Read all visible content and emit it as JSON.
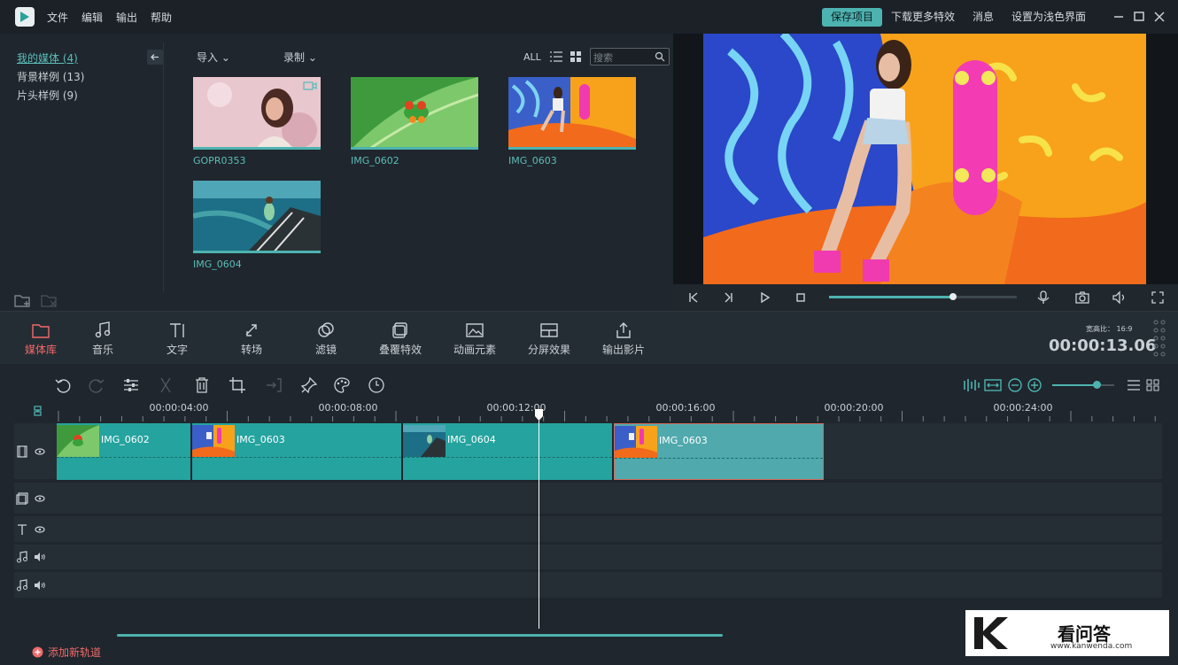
{
  "menu": {
    "file": "文件",
    "edit": "编辑",
    "export": "输出",
    "help": "帮助"
  },
  "titlebar": {
    "save": "保存项目",
    "download": "下载更多特效",
    "messages": "消息",
    "light_mode": "设置为浅色界面"
  },
  "library": {
    "items": [
      {
        "label": "我的媒体 (4)"
      },
      {
        "label": "背景样例 (13)"
      },
      {
        "label": "片头样例 (9)"
      }
    ],
    "import": "导入",
    "record": "录制",
    "all": "ALL",
    "search_placeholder": "搜索",
    "media": [
      {
        "name": "GOPR0353"
      },
      {
        "name": "IMG_0602"
      },
      {
        "name": "IMG_0603"
      },
      {
        "name": "IMG_0604"
      }
    ]
  },
  "player": {
    "progress": 0.66
  },
  "tools": [
    {
      "label": "媒体库",
      "icon": "folder-icon"
    },
    {
      "label": "音乐",
      "icon": "music-icon"
    },
    {
      "label": "文字",
      "icon": "text-icon"
    },
    {
      "label": "转场",
      "icon": "transition-icon"
    },
    {
      "label": "滤镜",
      "icon": "filter-icon"
    },
    {
      "label": "叠覆特效",
      "icon": "overlay-icon"
    },
    {
      "label": "动画元素",
      "icon": "image-icon"
    },
    {
      "label": "分屏效果",
      "icon": "split-screen-icon"
    },
    {
      "label": "输出影片",
      "icon": "export-icon"
    }
  ],
  "status": {
    "aspect": "宽高比： 16:9",
    "timecode": "00:00:13.06"
  },
  "timeline": {
    "ruler": [
      "00:00:04:00",
      "00:00:08:00",
      "00:00:12:00",
      "00:00:16:00",
      "00:00:20:00",
      "00:00:24:00"
    ],
    "clips": [
      {
        "name": "IMG_0602"
      },
      {
        "name": "IMG_0603"
      },
      {
        "name": "IMG_0604"
      },
      {
        "name": "IMG_0603"
      }
    ],
    "add_track": "添加新轨道",
    "zoom": 0.72
  },
  "watermark": {
    "text": "看问答",
    "url": "www.kanwenda.com"
  },
  "colors": {
    "accent": "#4db3b0",
    "clip": "#25a39f",
    "active_tool": "#f06a6a"
  }
}
